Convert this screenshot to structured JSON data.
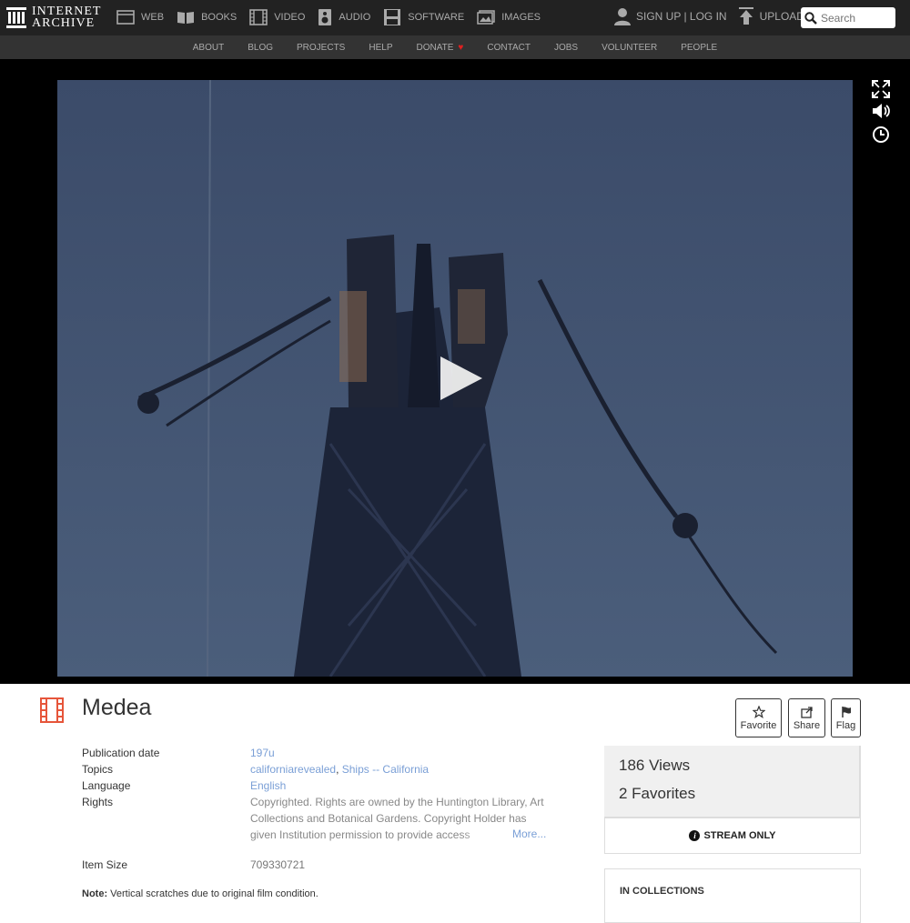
{
  "brand": {
    "line1": "INTERNET",
    "line2": "ARCHIVE"
  },
  "mainnav": [
    {
      "label": "WEB",
      "icon": "web-icon"
    },
    {
      "label": "BOOKS",
      "icon": "books-icon"
    },
    {
      "label": "VIDEO",
      "icon": "film-icon"
    },
    {
      "label": "AUDIO",
      "icon": "speaker-icon"
    },
    {
      "label": "SOFTWARE",
      "icon": "floppy-icon"
    },
    {
      "label": "IMAGES",
      "icon": "images-icon"
    }
  ],
  "user": {
    "signin": "SIGN UP | LOG IN",
    "upload": "UPLOAD"
  },
  "search": {
    "placeholder": "Search"
  },
  "subnav": [
    "ABOUT",
    "BLOG",
    "PROJECTS",
    "HELP",
    "DONATE",
    "CONTACT",
    "JOBS",
    "VOLUNTEER",
    "PEOPLE"
  ],
  "item": {
    "title": "Medea",
    "actions": {
      "favorite": "Favorite",
      "share": "Share",
      "flag": "Flag"
    },
    "metadata": {
      "pub_date_label": "Publication date",
      "pub_date": "197u",
      "topics_label": "Topics",
      "topics": [
        "californiarevealed",
        "Ships -- California"
      ],
      "topics_sep": ", ",
      "language_label": "Language",
      "language": "English",
      "rights_label": "Rights",
      "rights": "Copyrighted. Rights are owned by the Huntington Library, Art Collections and Botanical Gardens. Copyright Holder has given Institution permission to provide access",
      "more": "More...",
      "size_label": "Item Size",
      "size": "709330721",
      "note_label": "Note:",
      "note": " Vertical scratches due to original film condition."
    },
    "stats": {
      "views": "186 Views",
      "favorites": "2 Favorites"
    },
    "stream": "STREAM ONLY",
    "collections_title": "IN COLLECTIONS"
  },
  "colors": {
    "accent_red": "#e6553a",
    "link": "#7a9fd6",
    "topbar": "#222222",
    "subnav": "#333333"
  }
}
